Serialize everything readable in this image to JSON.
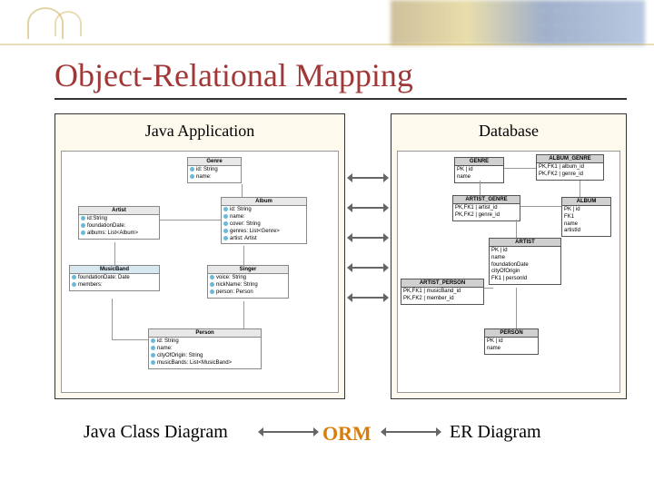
{
  "title": "Object-Relational Mapping",
  "panel_left": {
    "title": "Java Application",
    "caption": "Java Class Diagram",
    "classes": {
      "genre": {
        "name": "Genre",
        "attrs": [
          "id: String",
          "name:"
        ]
      },
      "artist": {
        "name": "Artist",
        "attrs": [
          "id:String",
          "foundationDate:",
          "albums: List<Album>"
        ]
      },
      "album": {
        "name": "Album",
        "attrs": [
          "id: String",
          "name:",
          "cover: String",
          "genres: List<Genre>",
          "artist: Artist"
        ]
      },
      "musicband": {
        "name": "MusicBand",
        "attrs": [
          "foundationDate: Date",
          "members:"
        ]
      },
      "singer": {
        "name": "Singer",
        "attrs": [
          "voice: String",
          "nickName: String",
          "person: Person"
        ]
      },
      "person": {
        "name": "Person",
        "attrs": [
          "id: String",
          "name:",
          "cityOfOrigin: String",
          "musicBands: List<MusicBand>"
        ]
      }
    }
  },
  "panel_right": {
    "title": "Database",
    "caption": "ER Diagram",
    "tables": {
      "genre": {
        "name": "GENRE",
        "cols": [
          "PK | id",
          "",
          "name"
        ]
      },
      "album_genre": {
        "name": "ALBUM_GENRE",
        "cols": [
          "PK,FK1 | album_id",
          "PK,FK2 | genre_id"
        ]
      },
      "artist_genre": {
        "name": "ARTIST_GENRE",
        "cols": [
          "PK,FK1 | artist_id",
          "PK,FK2 | genre_id"
        ]
      },
      "album": {
        "name": "ALBUM",
        "cols": [
          "PK | id",
          "",
          "FK1",
          "name",
          "artistId"
        ]
      },
      "artist": {
        "name": "ARTIST",
        "cols": [
          "PK | id",
          "",
          "name",
          "foundationDate",
          "cityOfOrigin",
          "FK1 | personId"
        ]
      },
      "artist_person": {
        "name": "ARTIST_PERSON",
        "cols": [
          "PK,FK1 | musicBand_id",
          "PK,FK2 | member_id"
        ]
      },
      "person": {
        "name": "PERSON",
        "cols": [
          "PK | id",
          "",
          "name"
        ]
      }
    }
  },
  "orm_label": "ORM"
}
